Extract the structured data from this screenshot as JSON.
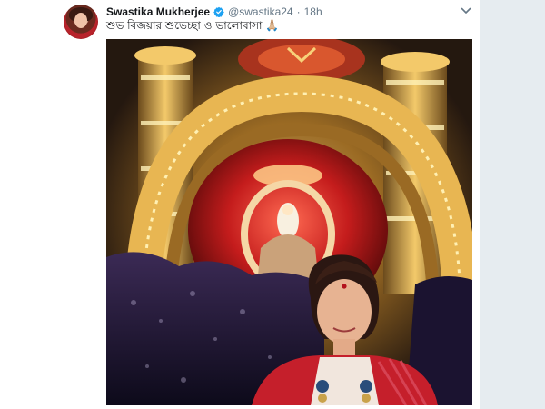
{
  "tweet": {
    "author_name": "Swastika Mukherjee",
    "handle": "@swastika24",
    "separator": "·",
    "time": "18h",
    "text": "শুভ বিজয়ার শুভেচ্ছা ও ভালোবাসা 🙏🏼"
  },
  "icons": {
    "verified": "verified-badge-icon",
    "caret": "chevron-down-icon"
  },
  "colors": {
    "name": "#14171a",
    "meta": "#657786",
    "verified": "#1da1f2",
    "rail": "#e6ecf0"
  }
}
